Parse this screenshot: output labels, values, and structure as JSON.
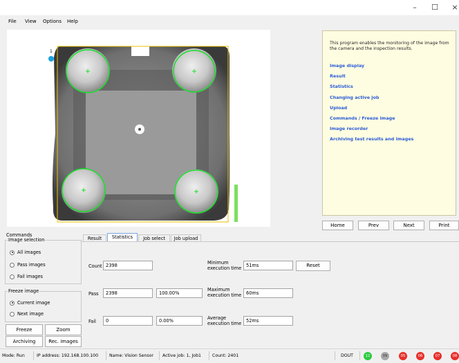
{
  "window": {
    "minimize_glyph": "–",
    "maximize_glyph": "☐",
    "close_glyph": "×"
  },
  "menu": [
    "File",
    "View",
    "Options",
    "Help"
  ],
  "image_view": {
    "roi_label": "1",
    "colors": {
      "detection": "#18e02a",
      "roi": "#e8c200",
      "bar": "#7be05f"
    }
  },
  "help": {
    "intro": "This program enables the monitoring of the image from the camera and the inspection results.",
    "links": [
      "Image display",
      "Result",
      "Statistics",
      "Changing active job",
      "Upload",
      "Commands / Freeze image",
      "Image recorder",
      "Archiving test results and images"
    ],
    "buttons": {
      "home": "Home",
      "prev": "Prev",
      "next": "Next",
      "print": "Print"
    }
  },
  "commands": {
    "title": "Commands",
    "image_selection": {
      "title": "Image selection",
      "options": [
        "All images",
        "Pass images",
        "Fail images"
      ],
      "selected": "All images"
    },
    "freeze_image": {
      "title": "Freeze image",
      "options": [
        "Current image",
        "Next image"
      ],
      "selected": "Current image"
    },
    "buttons": {
      "freeze": "Freeze",
      "zoom": "Zoom",
      "archiving": "Archiving",
      "rec_images": "Rec. images"
    }
  },
  "tabs": [
    "Result",
    "Statistics",
    "Job select",
    "Job upload"
  ],
  "active_tab": "Statistics",
  "statistics": {
    "count_label": "Count",
    "count": "2398",
    "pass_label": "Pass",
    "pass": "2398",
    "pass_pct": "100.00%",
    "fail_label": "Fail",
    "fail": "0",
    "fail_pct": "0.00%",
    "min_label_1": "Minimum",
    "min_label_2": "execution time",
    "min_value": "51ms",
    "max_label_1": "Maximum",
    "max_label_2": "execution time",
    "max_value": "60ms",
    "avg_label_1": "Average",
    "avg_label_2": "execution time",
    "avg_value": "52ms",
    "reset": "Reset"
  },
  "status": {
    "mode": "Mode:  Run",
    "ip": "IP address:  192.168.100.100",
    "name": "Name:  Vision Sensor",
    "job": "Active job:  1, Job1",
    "count": "Count:  2401",
    "dout": "DOUT",
    "leds": [
      {
        "label": "12",
        "color": "#2ecc40"
      },
      {
        "label": "09",
        "color": "#a8a8a8"
      },
      {
        "label": "05",
        "color": "#e8302a"
      },
      {
        "label": "06",
        "color": "#e8302a"
      },
      {
        "label": "07",
        "color": "#e8302a"
      },
      {
        "label": "08",
        "color": "#e8302a"
      }
    ]
  }
}
